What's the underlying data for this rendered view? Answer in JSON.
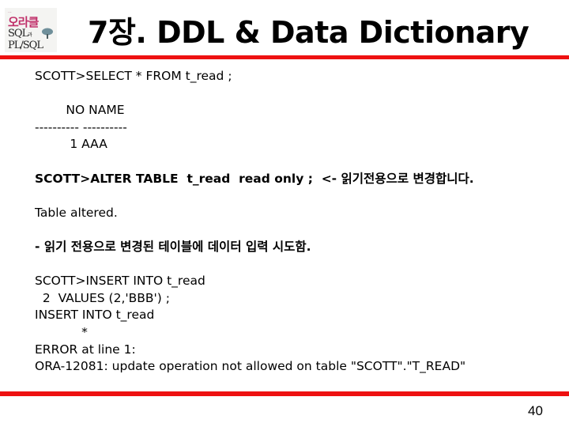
{
  "logo": {
    "top_caption": "...",
    "brand": "오라클",
    "line2": "SQL",
    "line2_suffix": "과",
    "line3": "PL/SQL"
  },
  "slide": {
    "title": "7장. DDL & Data Dictionary",
    "page_number": "40",
    "accent_color": "#ee1111"
  },
  "content": {
    "lines": [
      {
        "text": "SCOTT>SELECT * FROM t_read ;",
        "bold": false
      },
      {
        "text": "",
        "bold": false
      },
      {
        "text": "        NO NAME",
        "bold": false
      },
      {
        "text": "---------- ----------",
        "bold": false
      },
      {
        "text": "         1 AAA",
        "bold": false
      },
      {
        "text": "",
        "bold": false
      },
      {
        "text": "SCOTT>ALTER TABLE  t_read  read only ;  <- 읽기전용으로 변경합니다.",
        "bold": true
      },
      {
        "text": "",
        "bold": false
      },
      {
        "text": "Table altered.",
        "bold": false
      },
      {
        "text": "",
        "bold": false
      },
      {
        "text": "- 읽기 전용으로 변경된 테이블에 데이터 입력 시도함.",
        "bold": true
      },
      {
        "text": "",
        "bold": false
      },
      {
        "text": "SCOTT>INSERT INTO t_read",
        "bold": false
      },
      {
        "text": "  2  VALUES (2,'BBB') ;",
        "bold": false
      },
      {
        "text": "INSERT INTO t_read",
        "bold": false
      },
      {
        "text": "            *",
        "bold": false
      },
      {
        "text": "ERROR at line 1:",
        "bold": false
      },
      {
        "text": "ORA-12081: update operation not allowed on table \"SCOTT\".\"T_READ\"",
        "bold": false
      }
    ]
  }
}
